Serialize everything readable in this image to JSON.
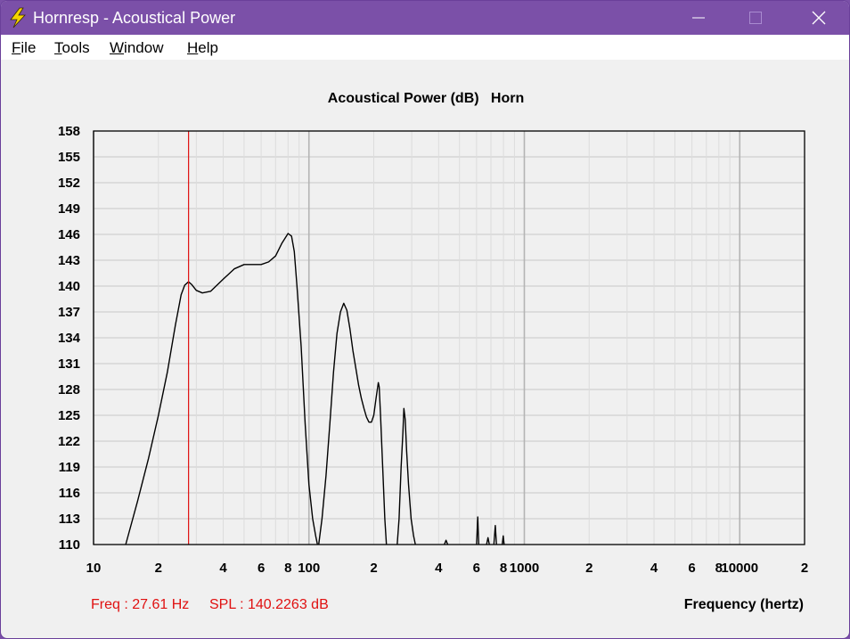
{
  "window": {
    "title": "Hornresp - Acoustical Power"
  },
  "menu": [
    {
      "first": "F",
      "rest": "ile"
    },
    {
      "first": "T",
      "rest": "ools"
    },
    {
      "first": "W",
      "rest": "indow"
    },
    {
      "first": "H",
      "rest": "elp"
    }
  ],
  "colors": {
    "titlebar": "#7b50a8",
    "curve": "#000000",
    "marker": "#e01010",
    "grid": "#c8c8c8"
  },
  "status": {
    "freq": "Freq : 27.61 Hz",
    "spl": "SPL : 140.2263 dB"
  },
  "chart_data": {
    "type": "line",
    "title": "Acoustical Power (dB)   Horn",
    "xlabel": "Frequency (hertz)",
    "ylabel": "",
    "xscale": "log",
    "xlim": [
      10,
      20000
    ],
    "ylim": [
      110,
      158
    ],
    "grid": true,
    "y_ticks": [
      "158",
      "155",
      "152",
      "149",
      "146",
      "143",
      "140",
      "137",
      "134",
      "131",
      "128",
      "125",
      "122",
      "119",
      "116",
      "113",
      "110"
    ],
    "x_ticks": [
      {
        "value": 10,
        "label": "10"
      },
      {
        "value": 20,
        "label": "2"
      },
      {
        "value": 40,
        "label": "4"
      },
      {
        "value": 60,
        "label": "6"
      },
      {
        "value": 80,
        "label": "8"
      },
      {
        "value": 100,
        "label": "100"
      },
      {
        "value": 200,
        "label": "2"
      },
      {
        "value": 400,
        "label": "4"
      },
      {
        "value": 600,
        "label": "6"
      },
      {
        "value": 800,
        "label": "8"
      },
      {
        "value": 1000,
        "label": "1000"
      },
      {
        "value": 2000,
        "label": "2"
      },
      {
        "value": 4000,
        "label": "4"
      },
      {
        "value": 6000,
        "label": "6"
      },
      {
        "value": 8000,
        "label": "8"
      },
      {
        "value": 10000,
        "label": "10000"
      },
      {
        "value": 20000,
        "label": "2"
      }
    ],
    "marker": {
      "x": 27.61,
      "y": 140.2263
    },
    "series": [
      {
        "x": [
          14.1,
          16,
          18,
          20,
          22,
          24,
          25.5,
          26.5,
          27.6,
          28.5,
          30,
          32,
          35,
          40,
          45,
          50,
          55,
          60,
          65,
          70,
          75,
          80,
          83,
          85.5,
          88,
          92,
          96,
          100,
          104,
          107.5,
          109.5
        ],
        "y": [
          110,
          115,
          120,
          125,
          130,
          135.5,
          139,
          140.1,
          140.5,
          140.2,
          139.5,
          139.2,
          139.4,
          140.8,
          142,
          142.5,
          142.5,
          142.5,
          142.8,
          143.5,
          145,
          146.1,
          145.8,
          144,
          140,
          133,
          124,
          117,
          113,
          111,
          110
        ]
      },
      {
        "x": [
          111,
          115,
          120,
          125,
          130,
          135,
          140,
          145,
          150,
          155,
          160,
          165,
          170,
          175,
          180,
          185,
          190,
          195,
          200,
          205,
          210,
          212,
          215,
          220,
          225,
          229
        ],
        "y": [
          110,
          113,
          118,
          124,
          130,
          134.5,
          137,
          138,
          137.2,
          135,
          132.5,
          130.5,
          128.5,
          127,
          125.8,
          124.8,
          124.2,
          124.2,
          125,
          127,
          128.8,
          128.3,
          125,
          119,
          113,
          110
        ]
      },
      {
        "x": [
          257,
          262,
          268,
          273,
          276,
          280,
          284,
          290,
          298,
          306,
          312
        ],
        "y": [
          110,
          113,
          119,
          123,
          125.8,
          124.5,
          121,
          117,
          113,
          111,
          110
        ]
      },
      {
        "x": [
          425,
          433,
          441
        ],
        "y": [
          110,
          110.5,
          110
        ]
      },
      {
        "x": [
          600,
          608,
          614
        ],
        "y": [
          110,
          113.2,
          110
        ]
      },
      {
        "x": [
          668,
          678,
          688
        ],
        "y": [
          110,
          110.8,
          110
        ]
      },
      {
        "x": [
          722,
          733,
          742
        ],
        "y": [
          110,
          112.2,
          110
        ]
      },
      {
        "x": [
          790,
          798,
          806
        ],
        "y": [
          110,
          111,
          110
        ]
      }
    ]
  }
}
